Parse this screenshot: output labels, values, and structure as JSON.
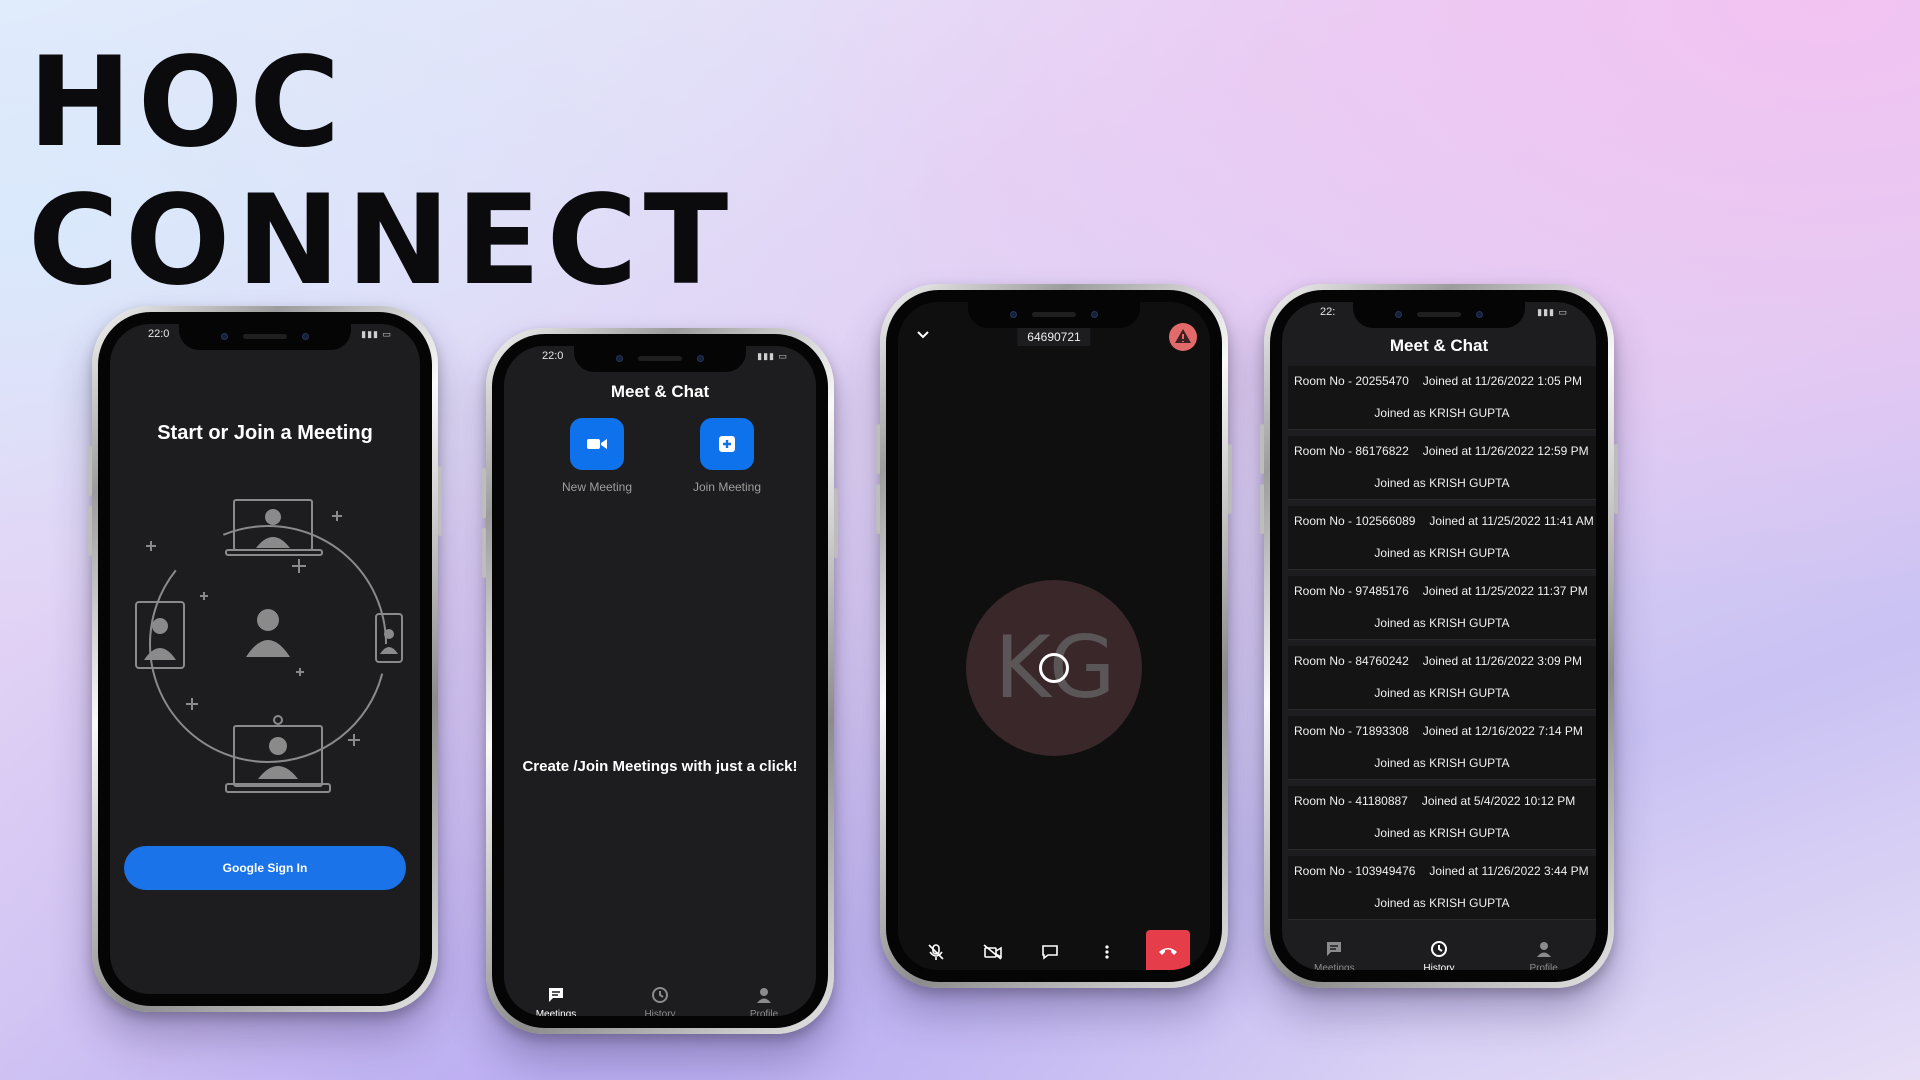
{
  "headline": {
    "line1": "HOC",
    "line2": "CONNECT"
  },
  "colors": {
    "accent": "#1a73e8",
    "action_blue": "#0e72ed",
    "hangup_red": "#e53e4a",
    "screen_bg": "#1d1d1f"
  },
  "phone1": {
    "status_time": "22:0",
    "heading": "Start or Join a Meeting",
    "illustration_icon": "people-network-illustration",
    "google_button": "Google Sign In"
  },
  "phone2": {
    "status_time": "22:0",
    "app_title": "Meet & Chat",
    "actions": [
      {
        "label": "New Meeting",
        "icon": "video-camera-icon"
      },
      {
        "label": "Join Meeting",
        "icon": "plus-square-icon"
      }
    ],
    "tagline": "Create /Join Meetings with just a click!",
    "nav": [
      {
        "label": "Meetings",
        "icon": "chat-icon"
      },
      {
        "label": "History",
        "icon": "history-icon"
      },
      {
        "label": "Profile",
        "icon": "person-icon"
      }
    ]
  },
  "phone3": {
    "room_id": "64690721",
    "avatar_initials": "KG",
    "controls": [
      "mic-off-icon",
      "video-off-icon",
      "chat-icon",
      "more-icon",
      "hangup-icon"
    ]
  },
  "phone4": {
    "status_time": "22:",
    "app_title": "Meet & Chat",
    "history": [
      {
        "room": "Room No - 20255470",
        "joined_at": "Joined at 11/26/2022 1:05 PM",
        "joined_as": "Joined as KRISH GUPTA"
      },
      {
        "room": "Room No - 86176822",
        "joined_at": "Joined at 11/26/2022 12:59 PM",
        "joined_as": "Joined as KRISH GUPTA"
      },
      {
        "room": "Room No - 102566089",
        "joined_at": "Joined at 11/25/2022 11:41 AM",
        "joined_as": "Joined as KRISH GUPTA"
      },
      {
        "room": "Room No - 97485176",
        "joined_at": "Joined at 11/25/2022 11:37 PM",
        "joined_as": "Joined as KRISH GUPTA"
      },
      {
        "room": "Room No - 84760242",
        "joined_at": "Joined at 11/26/2022 3:09 PM",
        "joined_as": "Joined as KRISH GUPTA"
      },
      {
        "room": "Room No - 71893308",
        "joined_at": "Joined at 12/16/2022 7:14 PM",
        "joined_as": "Joined as KRISH GUPTA"
      },
      {
        "room": "Room No - 41180887",
        "joined_at": "Joined at 5/4/2022 10:12 PM",
        "joined_as": "Joined as KRISH GUPTA"
      },
      {
        "room": "Room No - 103949476",
        "joined_at": "Joined at 11/26/2022 3:44 PM",
        "joined_as": "Joined as KRISH GUPTA"
      }
    ],
    "nav": [
      {
        "label": "Meetings",
        "icon": "chat-icon"
      },
      {
        "label": "History",
        "icon": "history-icon"
      },
      {
        "label": "Profile",
        "icon": "person-icon"
      }
    ]
  }
}
